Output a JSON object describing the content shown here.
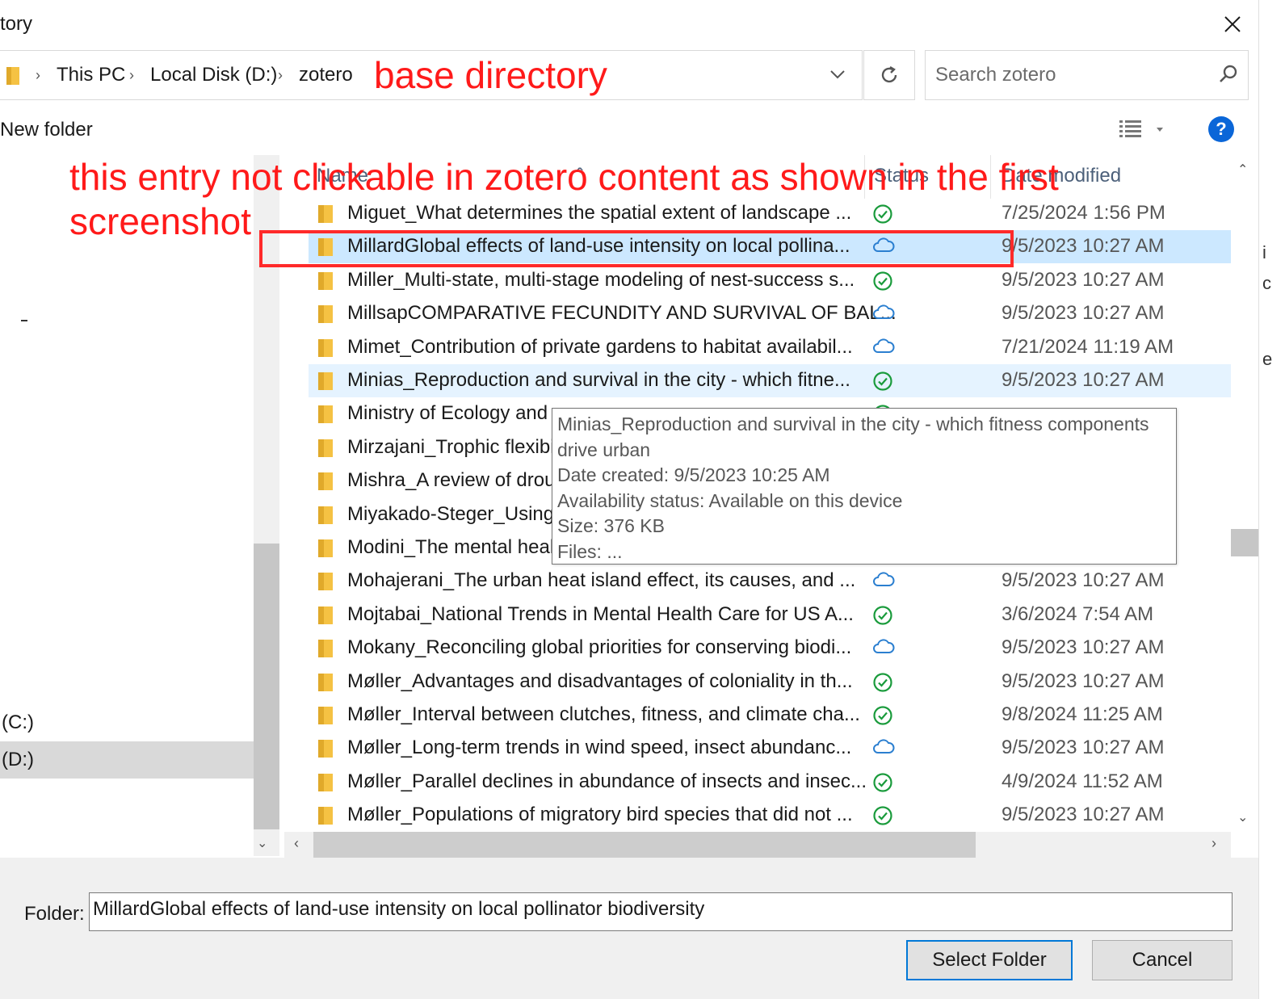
{
  "window": {
    "title": "tory"
  },
  "address": {
    "crumbs": [
      "This PC",
      "Local Disk (D:)",
      "zotero"
    ]
  },
  "search": {
    "placeholder": "Search zotero"
  },
  "annotations": {
    "base_dir": "base directory",
    "entry_note_line1": "this entry not clickable in zotero content as shown in the first",
    "entry_note_line2": "screenshot"
  },
  "toolbar": {
    "new_folder": "New folder",
    "help": "?"
  },
  "nav": {
    "items": [
      {
        "label": "(C:)",
        "selected": false
      },
      {
        "label": "(D:)",
        "selected": true
      }
    ]
  },
  "columns": {
    "name": "Name",
    "status": "Status",
    "date": "Date modified"
  },
  "files": [
    {
      "name": "Miguet_What determines the spatial extent of landscape ...",
      "status": "available",
      "date": "7/25/2024 1:56 PM"
    },
    {
      "name": "MillardGlobal effects of land-use intensity on local pollina...",
      "status": "cloud",
      "date": "9/5/2023 10:27 AM"
    },
    {
      "name": "Miller_Multi-state, multi-stage modeling of nest-success s...",
      "status": "available",
      "date": "9/5/2023 10:27 AM"
    },
    {
      "name": "MillsapCOMPARATIVE FECUNDITY AND SURVIVAL OF BAL...",
      "status": "cloud",
      "date": "9/5/2023 10:27 AM"
    },
    {
      "name": "Mimet_Contribution of private gardens to habitat availabil...",
      "status": "cloud",
      "date": "7/21/2024 11:19 AM"
    },
    {
      "name": "Minias_Reproduction and survival in the city - which fitne...",
      "status": "available",
      "date": "9/5/2023 10:27 AM"
    },
    {
      "name": "Ministry of Ecology and",
      "status": "available",
      "date": ""
    },
    {
      "name": "Mirzajani_Trophic flexibi",
      "status": "",
      "date": ""
    },
    {
      "name": "Mishra_A review of drou",
      "status": "",
      "date": ""
    },
    {
      "name": "Miyakado-Steger_Using",
      "status": "",
      "date": ""
    },
    {
      "name": "Modini_The mental heal",
      "status": "",
      "date": ""
    },
    {
      "name": "Mohajerani_The urban heat island effect, its causes, and ...",
      "status": "cloud",
      "date": "9/5/2023 10:27 AM"
    },
    {
      "name": "Mojtabai_National Trends in Mental Health Care for US A...",
      "status": "available",
      "date": "3/6/2024 7:54 AM"
    },
    {
      "name": "Mokany_Reconciling global priorities for conserving biodi...",
      "status": "cloud",
      "date": "9/5/2023 10:27 AM"
    },
    {
      "name": "Møller_Advantages and disadvantages of coloniality in th...",
      "status": "available",
      "date": "9/5/2023 10:27 AM"
    },
    {
      "name": "Møller_Interval between clutches, fitness, and climate cha...",
      "status": "available",
      "date": "9/8/2024 11:25 AM"
    },
    {
      "name": "Møller_Long-term trends in wind speed, insect abundanc...",
      "status": "cloud",
      "date": "9/5/2023 10:27 AM"
    },
    {
      "name": "Møller_Parallel declines in abundance of insects and insec...",
      "status": "available",
      "date": "4/9/2024 11:52 AM"
    },
    {
      "name": "Møller_Populations of migratory bird species that did not ...",
      "status": "available",
      "date": "9/5/2023 10:27 AM"
    }
  ],
  "selected_index": 1,
  "hover_index": 5,
  "tooltip": {
    "lines": [
      "Minias_Reproduction and survival in the city - which fitness components",
      "drive urban",
      "Date created: 9/5/2023 10:25 AM",
      "Availability status: Available on this device",
      "Size: 376 KB",
      "Files: ..."
    ]
  },
  "footer": {
    "folder_label": "Folder:",
    "folder_value": "MillardGlobal effects of land-use intensity on local pollinator biodiversity",
    "select_label": "Select Folder",
    "cancel_label": "Cancel"
  },
  "colors": {
    "accent": "#0078d7",
    "annotation": "#ff1a1a",
    "selected_row": "#cce8ff",
    "hover_row": "#e5f3ff",
    "status_ok": "#1a9b3c",
    "status_cloud": "#2b7fd0"
  },
  "icons": {
    "folder": "folder-icon",
    "available": "check-circle-icon",
    "cloud": "cloud-icon"
  }
}
